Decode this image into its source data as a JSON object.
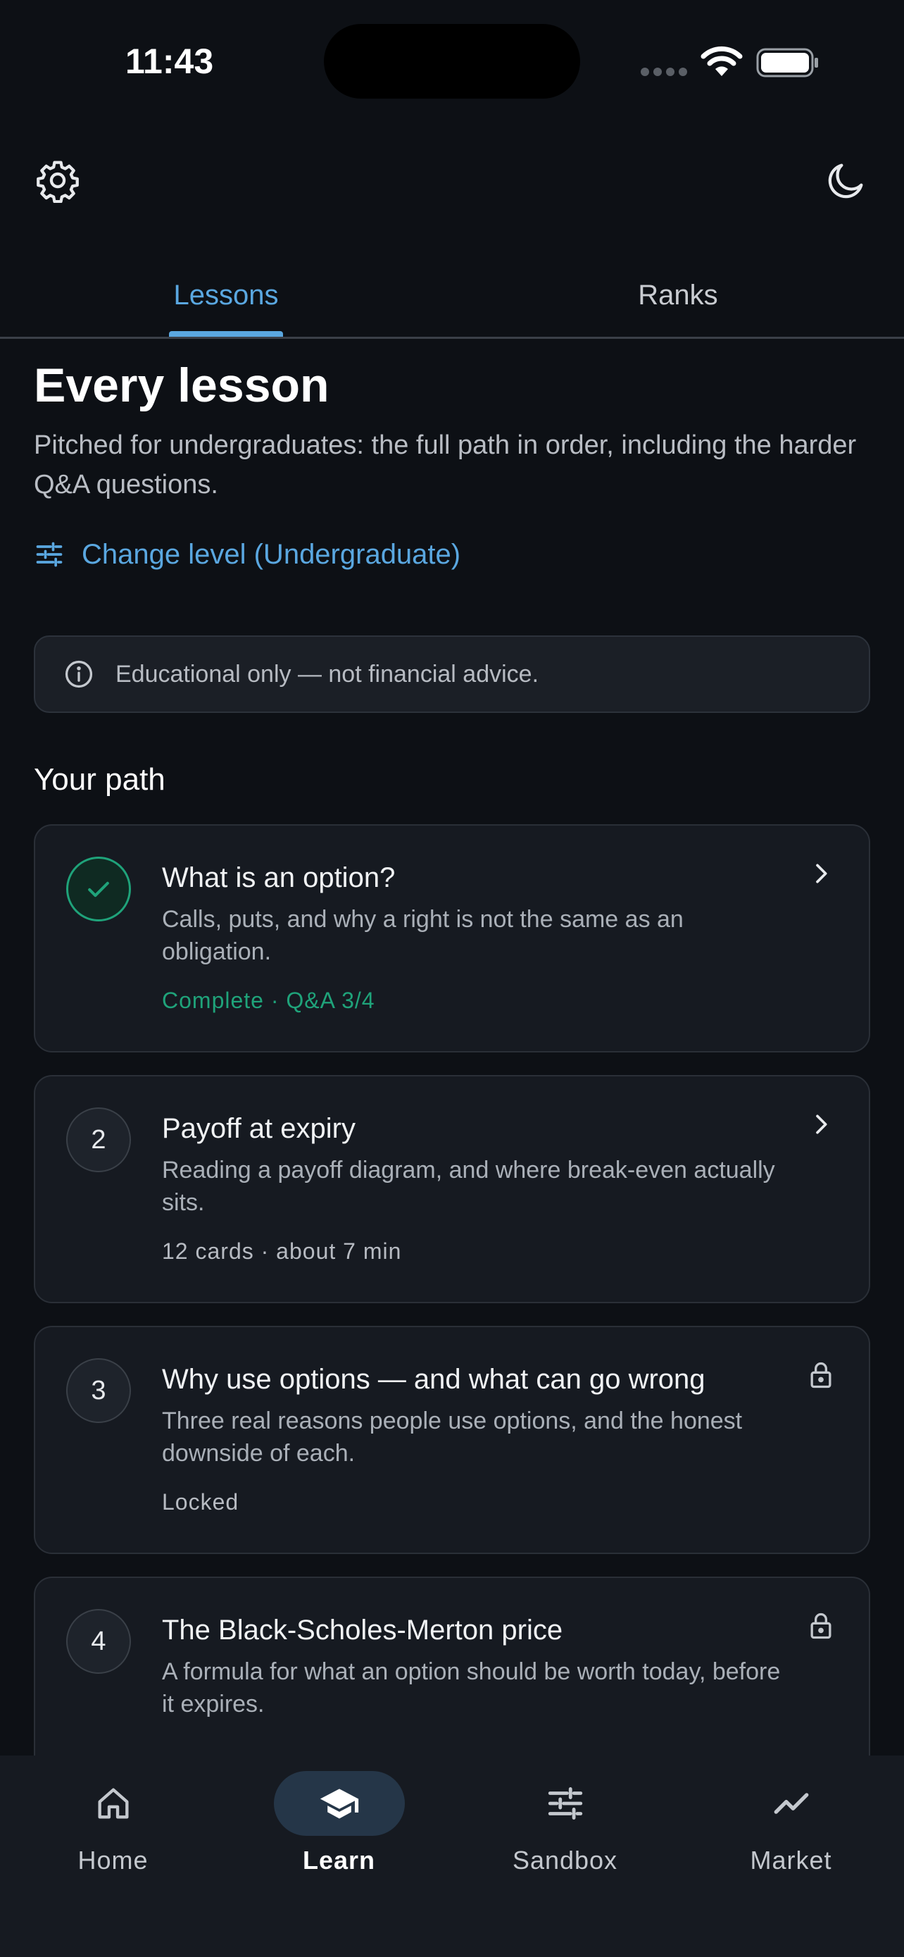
{
  "status_bar": {
    "time": "11:43"
  },
  "tabs": [
    {
      "label": "Lessons",
      "selected": true
    },
    {
      "label": "Ranks",
      "selected": false
    }
  ],
  "header": {
    "title": "Every lesson",
    "intro": "Pitched for undergraduates: the full path in order, including the harder Q&A questions.",
    "change_level": "Change level (Undergraduate)"
  },
  "notice": "Educational only — not financial advice.",
  "path": {
    "title": "Your path",
    "lessons": [
      {
        "badge": "",
        "status_icon": "check-icon",
        "title": "What is an option?",
        "description": "Calls, puts, and why a right is not the same as an obligation.",
        "meta": "Complete · Q&A 3/4",
        "trailing_icon": "chevron-right-icon"
      },
      {
        "badge": "2",
        "title": "Payoff at expiry",
        "description": "Reading a payoff diagram, and where break-even actually sits.",
        "meta": "12 cards · about 7 min",
        "trailing_icon": "chevron-right-icon"
      },
      {
        "badge": "3",
        "title": "Why use options — and what can go wrong",
        "description": "Three real reasons people use options, and the honest downside of each.",
        "meta": "Locked",
        "trailing_icon": "lock-icon"
      },
      {
        "badge": "4",
        "title": "The Black-Scholes-Merton price",
        "description": "A formula for what an option should be worth today, before it expires.",
        "meta": "",
        "trailing_icon": "lock-icon"
      }
    ]
  },
  "bottom_nav": [
    {
      "label": "Home",
      "icon": "home-icon",
      "selected": false
    },
    {
      "label": "Learn",
      "icon": "graduation-cap-icon",
      "selected": true
    },
    {
      "label": "Sandbox",
      "icon": "sliders-icon",
      "selected": false
    },
    {
      "label": "Market",
      "icon": "trend-line-icon",
      "selected": false
    }
  ],
  "colors": {
    "accent": "#5aa7e0",
    "success": "#1fa37a",
    "background": "#0d1015",
    "card": "#161a21"
  }
}
